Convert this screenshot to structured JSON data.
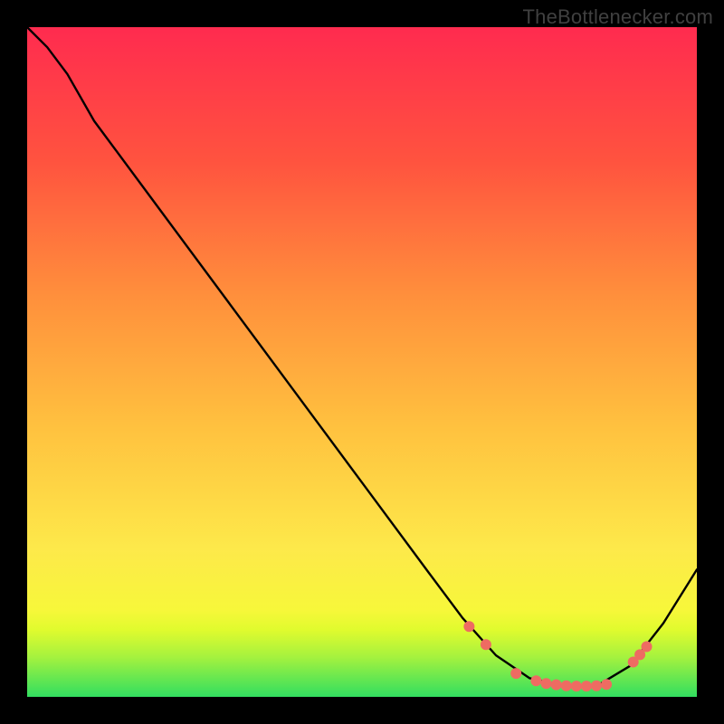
{
  "watermark": "TheBottlenecker.com",
  "chart_data": {
    "type": "line",
    "title": "",
    "xlabel": "",
    "ylabel": "",
    "xlim": [
      0,
      100
    ],
    "ylim": [
      0,
      100
    ],
    "gradient_stops": [
      {
        "offset": 0,
        "color": "#32de60"
      },
      {
        "offset": 3,
        "color": "#6be84f"
      },
      {
        "offset": 6,
        "color": "#a6f23e"
      },
      {
        "offset": 10,
        "color": "#e0fb2e"
      },
      {
        "offset": 13,
        "color": "#f7f73a"
      },
      {
        "offset": 22,
        "color": "#fde94a"
      },
      {
        "offset": 40,
        "color": "#ffc23f"
      },
      {
        "offset": 60,
        "color": "#ff8f3c"
      },
      {
        "offset": 80,
        "color": "#ff533f"
      },
      {
        "offset": 100,
        "color": "#ff2b4f"
      }
    ],
    "curve_points": [
      {
        "x": 0,
        "y": 100
      },
      {
        "x": 3,
        "y": 97
      },
      {
        "x": 6,
        "y": 93
      },
      {
        "x": 10,
        "y": 86
      },
      {
        "x": 20,
        "y": 72.5
      },
      {
        "x": 30,
        "y": 59
      },
      {
        "x": 40,
        "y": 45.5
      },
      {
        "x": 50,
        "y": 32
      },
      {
        "x": 60,
        "y": 18.5
      },
      {
        "x": 65,
        "y": 11.8
      },
      {
        "x": 70,
        "y": 6.2
      },
      {
        "x": 75,
        "y": 2.8
      },
      {
        "x": 80,
        "y": 1.6
      },
      {
        "x": 85,
        "y": 1.6
      },
      {
        "x": 90,
        "y": 4.6
      },
      {
        "x": 95,
        "y": 11
      },
      {
        "x": 100,
        "y": 19
      }
    ],
    "markers": [
      {
        "x": 66,
        "y": 10.5
      },
      {
        "x": 68.5,
        "y": 7.8
      },
      {
        "x": 73,
        "y": 3.5
      },
      {
        "x": 76,
        "y": 2.4
      },
      {
        "x": 77.5,
        "y": 2
      },
      {
        "x": 79,
        "y": 1.8
      },
      {
        "x": 80.5,
        "y": 1.65
      },
      {
        "x": 82,
        "y": 1.6
      },
      {
        "x": 83.5,
        "y": 1.6
      },
      {
        "x": 85,
        "y": 1.65
      },
      {
        "x": 86.5,
        "y": 1.85
      },
      {
        "x": 90.5,
        "y": 5.2
      },
      {
        "x": 91.5,
        "y": 6.3
      },
      {
        "x": 92.5,
        "y": 7.5
      }
    ],
    "marker_style": {
      "fill": "#ee6b62",
      "r": 6
    },
    "curve_style": {
      "stroke": "#000000",
      "width": 2.4
    }
  }
}
